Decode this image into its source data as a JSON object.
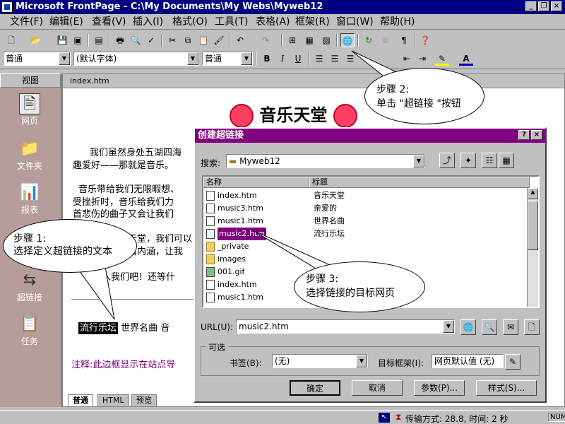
{
  "window": {
    "title": "Microsoft FrontPage - C:\\My Documents\\My Webs\\Myweb12"
  },
  "menu": [
    "文件(F)",
    "编辑(E)",
    "查看(V)",
    "插入(I)",
    "格式(O)",
    "工具(T)",
    "表格(A)",
    "框架(R)",
    "窗口(W)",
    "帮助(H)"
  ],
  "format": {
    "style": "普通",
    "font": "(默认字体)",
    "size": "普通"
  },
  "views": {
    "header": "视图",
    "items": [
      "网页",
      "文件夹",
      "报表",
      "导航",
      "超链接",
      "任务"
    ]
  },
  "editor": {
    "tab": "index.htm",
    "heading": "音乐天堂",
    "p1a": "我们虽然身处五湖四海",
    "p1b": "趣爱好——那就是音乐。",
    "p2a": "音乐带给我们无限暇想、",
    "p2b": "受挫折时，音乐给我们力",
    "p2c": "首悲伤的曲子又会让我们",
    "p3a": "天堂，我们可以",
    "p3b": "富内涵，让我",
    "p4": "加入我们吧！还等什",
    "links_selected": "流行乐坛",
    "links_rest": "世界名曲  音",
    "note": "注释:此边框显示在站点导"
  },
  "bottom_tabs": [
    "普通",
    "HTML",
    "预览"
  ],
  "status": {
    "text": "传输方式: 28.8, 时间: 2 秒",
    "num": "NUM"
  },
  "dialog": {
    "title": "创建超链接",
    "search_label": "搜索:",
    "folder": "Myweb12",
    "col_name": "名称",
    "col_title": "标题",
    "files": [
      {
        "name": "index.htm",
        "title": "音乐天堂",
        "kind": "page"
      },
      {
        "name": "music3.htm",
        "title": "亲爱的",
        "kind": "page"
      },
      {
        "name": "music1.htm",
        "title": "世界名曲",
        "kind": "page"
      },
      {
        "name": "music2.htm",
        "title": "流行乐坛",
        "kind": "page"
      },
      {
        "name": "_private",
        "title": "",
        "kind": "folder"
      },
      {
        "name": "images",
        "title": "",
        "kind": "folder"
      },
      {
        "name": "001.gif",
        "title": "",
        "kind": "image"
      },
      {
        "name": "index.htm",
        "title": "",
        "kind": "page"
      },
      {
        "name": "music1.htm",
        "title": "",
        "kind": "page"
      }
    ],
    "url_label": "URL(U):",
    "url_value": "music2.htm",
    "optional": "可选",
    "bookmark_label": "书签(B):",
    "bookmark_value": "(无)",
    "target_label": "目标框架(I):",
    "target_value": "网页默认值 (无)",
    "ok": "确定",
    "cancel": "取消",
    "params": "参数(P)...",
    "style": "样式(S)..."
  },
  "callouts": {
    "step1": "步骤 1:\n选择定义超链接的文本",
    "step2": "步骤 2:\n单击 \"超链接 \"按钮",
    "step3": "步骤 3:\n选择链接的目标网页"
  }
}
